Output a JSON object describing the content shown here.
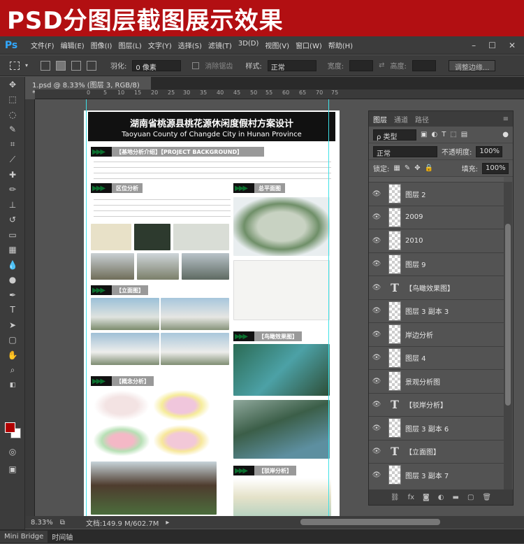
{
  "banner": {
    "text": "PSD分图层截图展示效果"
  },
  "app": {
    "logo": "Ps"
  },
  "menu": [
    "文件(F)",
    "编辑(E)",
    "图像(I)",
    "图层(L)",
    "文字(Y)",
    "选择(S)",
    "滤镜(T)",
    "3D(D)",
    "视图(V)",
    "窗口(W)",
    "帮助(H)"
  ],
  "window_controls": [
    "–",
    "☐",
    "✕"
  ],
  "options": {
    "feather_label": "羽化:",
    "feather_value": "0 像素",
    "antialias_label": "消除锯齿",
    "style_label": "样式:",
    "style_value": "正常",
    "width_label": "宽度:",
    "height_label": "高度:",
    "refine_button": "调整边缘..."
  },
  "document_tab": {
    "label": "1.psd @ 8.33% (图层 3, RGB/8) *",
    "close": "×"
  },
  "ruler_ticks": [
    "0",
    "5",
    "10",
    "15",
    "20",
    "25",
    "30",
    "35",
    "40",
    "45",
    "50",
    "55",
    "60",
    "65",
    "70",
    "75"
  ],
  "document": {
    "title_cn": "湖南省桃源县桃花源休闲度假村方案设计",
    "title_en": "Taoyuan County of Changde City in Hunan Province",
    "sec_background": "【基地分析介绍】【PROJECT BACKGROUND】",
    "sec_location": "区位分析",
    "sec_plan": "总平面图",
    "sec_elevation": "【立面图】",
    "sec_birdseye": "【鸟瞰效果图】",
    "sec_concept": "【概念分析】",
    "sec_shore": "【驳岸分析】"
  },
  "layers_panel": {
    "tabs": [
      "图层",
      "通道",
      "路径"
    ],
    "filter_label": "ρ 类型",
    "blend_mode": "正常",
    "opacity_label": "不透明度:",
    "opacity_value": "100%",
    "lock_label": "锁定:",
    "fill_label": "填充:",
    "fill_value": "100%",
    "layers": [
      {
        "name": "图层 2",
        "type": "image"
      },
      {
        "name": "2009",
        "type": "image"
      },
      {
        "name": "2010",
        "type": "image"
      },
      {
        "name": "图层 9",
        "type": "image"
      },
      {
        "name": "【鸟瞰效果图】",
        "type": "text"
      },
      {
        "name": "图层 3 副本 3",
        "type": "image"
      },
      {
        "name": "岸边分析",
        "type": "image"
      },
      {
        "name": "图层 4",
        "type": "image"
      },
      {
        "name": "景观分析图",
        "type": "image"
      },
      {
        "name": "【驳岸分析】",
        "type": "text"
      },
      {
        "name": "图层 3 副本 6",
        "type": "image"
      },
      {
        "name": "【立面图】",
        "type": "text"
      },
      {
        "name": "图层 3 副本 7",
        "type": "image"
      }
    ],
    "bottom_icons": [
      "link-icon",
      "fx-icon",
      "mask-icon",
      "adjustment-icon",
      "folder-icon",
      "new-layer-icon",
      "trash-icon"
    ]
  },
  "status": {
    "zoom": "8.33%",
    "doc_size": "文档:149.9 M/602.7M"
  },
  "bottom_tabs": [
    "Mini Bridge",
    "时间轴"
  ]
}
